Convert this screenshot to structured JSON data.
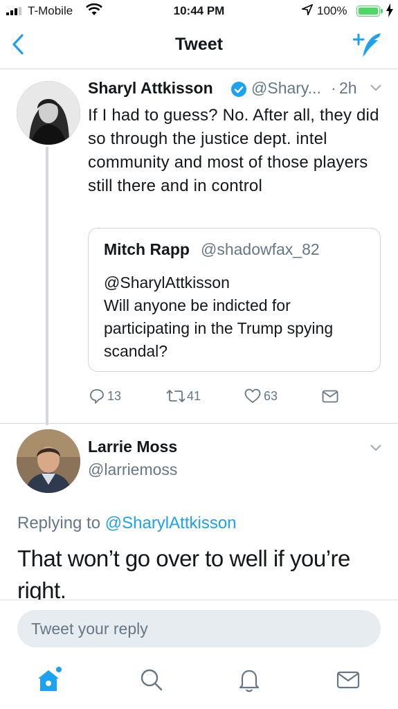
{
  "status_bar": {
    "carrier": "T-Mobile",
    "time": "10:44 PM",
    "battery_percent": "100%",
    "battery_level": 1.0,
    "accent_color": "#4cd964"
  },
  "nav": {
    "title": "Tweet",
    "back_icon": "chevron-left-icon",
    "compose_icon": "compose-tweet-icon",
    "accent_color": "#1da1f2"
  },
  "tweet": {
    "author_name": "Sharyl Attkisson",
    "handle": "@Shary...",
    "separator": "·",
    "time": "2h",
    "verified": true,
    "text": "If I had to guess? No. After all, they did so through the justice dept. intel community and most of those players still there and in control",
    "quote": {
      "author_name": "Mitch Rapp",
      "handle": "@shadowfax_82",
      "mention": "@SharylAttkisson",
      "text": "Will anyone be indicted for participating in the Trump spying scandal?"
    },
    "actions": {
      "replies": "13",
      "retweets": "41",
      "likes": "63"
    }
  },
  "reply": {
    "author_name": "Larrie Moss",
    "handle": "@larriemoss",
    "replying_label": "Replying to",
    "replying_to": "@SharylAttkisson",
    "text": "That won’t go over to well if you’re right."
  },
  "composer": {
    "placeholder": "Tweet your reply"
  },
  "tab_bar": {
    "items": [
      "home-icon",
      "search-icon",
      "notifications-icon",
      "messages-icon"
    ]
  }
}
